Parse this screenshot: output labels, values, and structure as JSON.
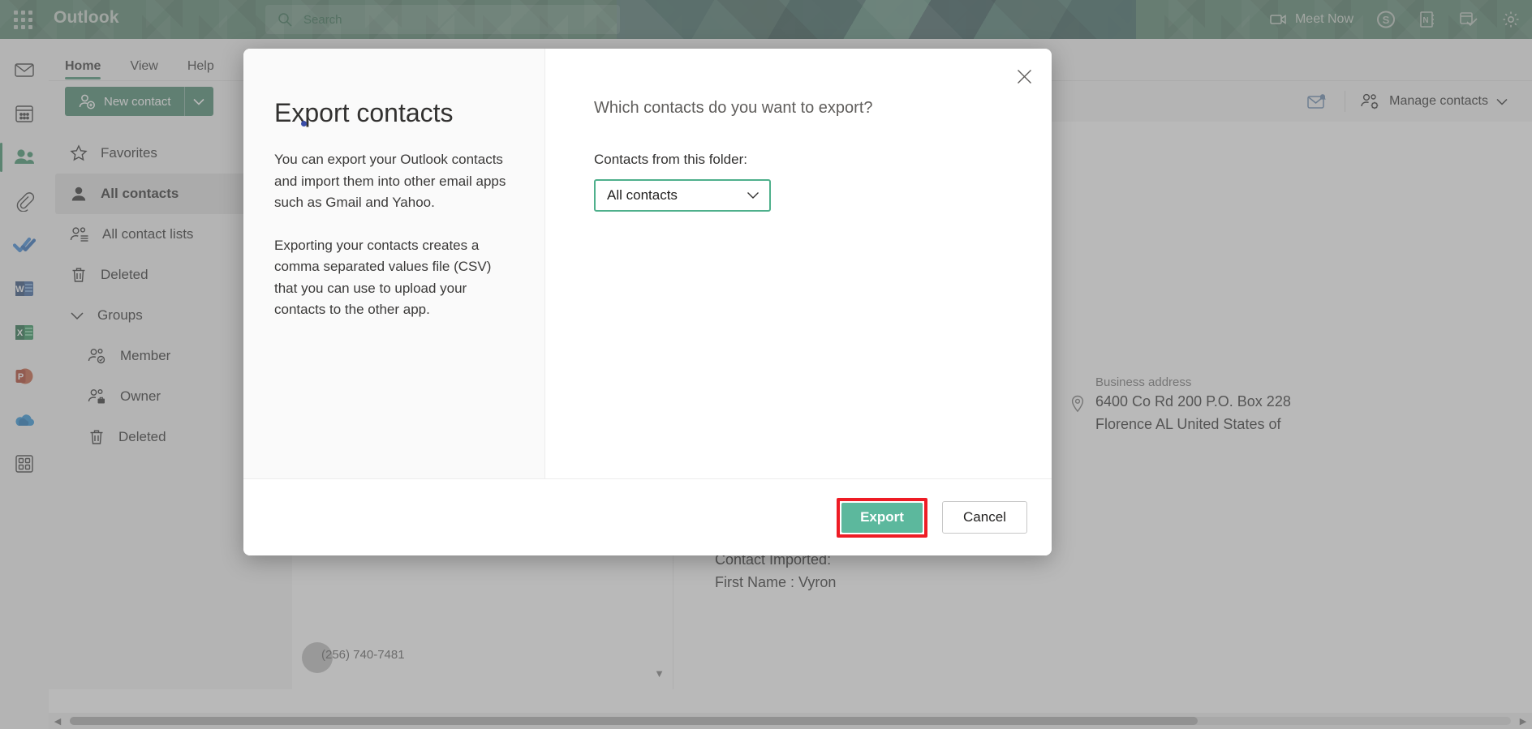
{
  "suite": {
    "waffle_icon": "app-launcher-icon",
    "brand": "Outlook",
    "search_placeholder": "Search",
    "search_icon": "search-icon",
    "meet_now": "Meet Now",
    "meet_now_icon": "video-camera-icon",
    "skype_icon": "skype-icon",
    "onenote_icon": "onenote-icon",
    "todo_icon": "calendar-check-icon",
    "settings_icon": "gear-icon"
  },
  "ribbon": {
    "tabs": [
      {
        "label": "Home",
        "active": true
      },
      {
        "label": "View",
        "active": false
      },
      {
        "label": "Help",
        "active": false
      }
    ]
  },
  "commandbar": {
    "new_contact": "New contact",
    "new_contact_icon": "add-person-icon",
    "new_contact_caret_icon": "chevron-down-icon",
    "mail_icon": "mail-alert-icon",
    "manage_contacts": "Manage contacts",
    "manage_contacts_icon": "people-gear-icon",
    "manage_contacts_caret_icon": "chevron-down-icon"
  },
  "rail": {
    "items": [
      {
        "name": "mail",
        "icon": "envelope-icon",
        "selected": false
      },
      {
        "name": "calendar",
        "icon": "calendar-icon",
        "selected": false
      },
      {
        "name": "people",
        "icon": "people-icon",
        "selected": true
      },
      {
        "name": "attachments",
        "icon": "paperclip-icon",
        "selected": false
      },
      {
        "name": "todo",
        "icon": "checkmark-icon",
        "selected": false
      },
      {
        "name": "word",
        "icon": "word-icon",
        "selected": false
      },
      {
        "name": "excel",
        "icon": "excel-icon",
        "selected": false
      },
      {
        "name": "powerpoint",
        "icon": "powerpoint-icon",
        "selected": false
      },
      {
        "name": "onedrive",
        "icon": "onedrive-icon",
        "selected": false
      },
      {
        "name": "more-apps",
        "icon": "grid-apps-icon",
        "selected": false
      }
    ]
  },
  "folders": {
    "items": [
      {
        "label": "Favorites",
        "icon": "star-icon",
        "selected": false,
        "sub": false
      },
      {
        "label": "All contacts",
        "icon": "person-filled-icon",
        "selected": true,
        "sub": false
      },
      {
        "label": "All contact lists",
        "icon": "people-list-icon",
        "selected": false,
        "sub": false
      },
      {
        "label": "Deleted",
        "icon": "trash-icon",
        "selected": false,
        "sub": false
      }
    ],
    "groups_label": "Groups",
    "groups_caret_icon": "chevron-down-icon",
    "group_items": [
      {
        "label": "Member",
        "icon": "people-check-icon"
      },
      {
        "label": "Owner",
        "icon": "people-briefcase-icon"
      },
      {
        "label": "Deleted",
        "icon": "trash-icon"
      }
    ]
  },
  "list_pane": {
    "phone": "(256) 740-7481",
    "avatar_icon": "avatar",
    "scroll_caret_icon": "caret-down-icon"
  },
  "reading_pane": {
    "business_address_label": "Business address",
    "pin_icon": "location-pin-icon",
    "address_line_1": "6400 Co Rd 200 P.O. Box 228",
    "address_line_2": "Florence AL United States of",
    "imported_line_1": "Contact Imported:",
    "imported_line_2": "First Name : Vyron"
  },
  "scrollbar": {
    "left_arrow_icon": "caret-left-icon",
    "right_arrow_icon": "caret-right-icon"
  },
  "dialog": {
    "title": "Export contacts",
    "paragraph_1": "You can export your Outlook contacts and import them into other email apps such as Gmail and Yahoo.",
    "paragraph_2": "Exporting your contacts creates a comma separated values file (CSV) that you can use to upload your contacts to the other app.",
    "question": "Which contacts do you want to export?",
    "field_label": "Contacts from this folder:",
    "select_value": "All contacts",
    "select_caret_icon": "chevron-down-icon",
    "close_icon": "close-icon",
    "export_label": "Export",
    "cancel_label": "Cancel"
  },
  "colors": {
    "brand_green": "#4a7a62",
    "accent_green": "#3b7f63",
    "export_teal": "#5cb89d",
    "focus_teal": "#4fb08c",
    "annotation_red": "#ee1c25"
  }
}
